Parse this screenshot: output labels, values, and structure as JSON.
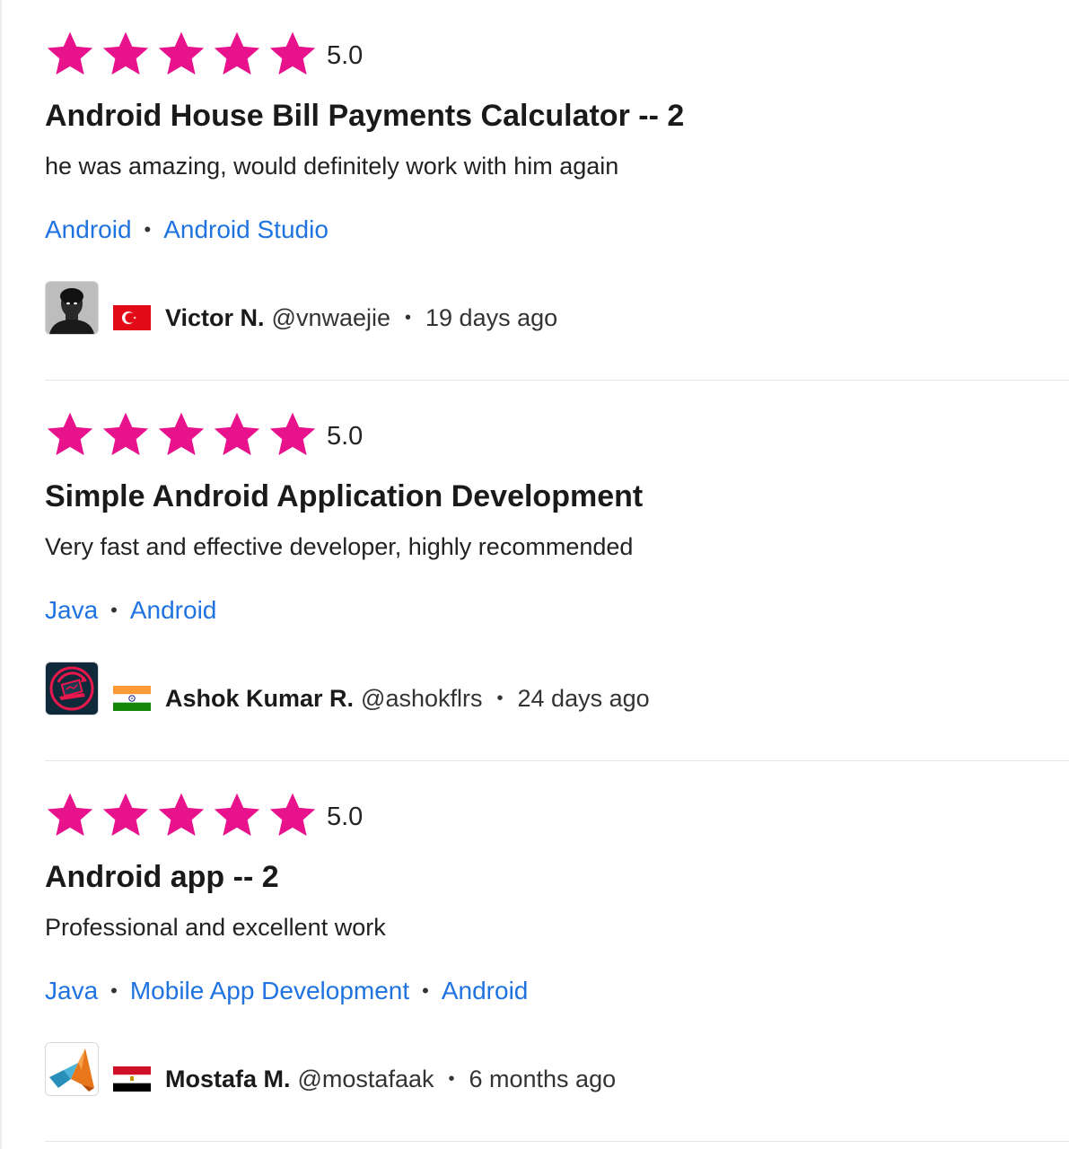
{
  "colors": {
    "star": "#e8128c",
    "skill_link": "#1f73e0",
    "divider": "#e6e6e6"
  },
  "reviews": [
    {
      "rating": "5.0",
      "stars": 5,
      "title": "Android House Bill Payments Calculator -- 2",
      "comment": "he was amazing, would definitely work with him again",
      "skills": [
        "Android",
        "Android Studio"
      ],
      "avatar_icon": "person-photo-avatar",
      "flag_icon": "turkey-flag-icon",
      "name": "Victor N.",
      "username": "@vnwaejie",
      "time": "19 days ago"
    },
    {
      "rating": "5.0",
      "stars": 5,
      "title": "Simple Android Application Development",
      "comment": "Very fast and effective developer, highly recommended",
      "skills": [
        "Java",
        "Android"
      ],
      "avatar_icon": "laptop-logo-avatar",
      "flag_icon": "india-flag-icon",
      "name": "Ashok Kumar R.",
      "username": "@ashokflrs",
      "time": "24 days ago"
    },
    {
      "rating": "5.0",
      "stars": 5,
      "title": "Android app -- 2",
      "comment": "Professional and excellent work",
      "skills": [
        "Java",
        "Mobile App Development",
        "Android"
      ],
      "avatar_icon": "matlab-logo-avatar",
      "flag_icon": "egypt-flag-icon",
      "name": "Mostafa M.",
      "username": "@mostafaak",
      "time": "6 months ago"
    }
  ]
}
